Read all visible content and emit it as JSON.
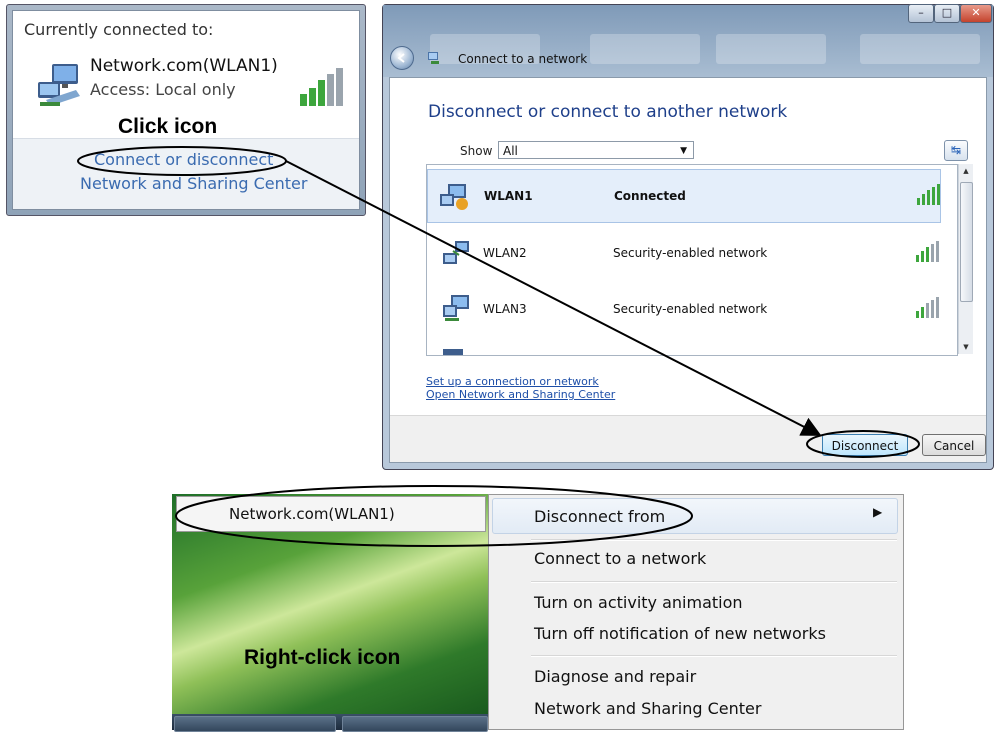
{
  "popup": {
    "heading": "Currently connected to:",
    "network_name": "Network.com(WLAN1)",
    "access": "Access:  Local only",
    "link_connect": "Connect or disconnect",
    "link_center": "Network and Sharing Center",
    "annotation": "Click icon"
  },
  "dialog": {
    "breadcrumb": "Connect to a network",
    "heading": "Disconnect or connect to another network",
    "show_label": "Show",
    "show_value": "All",
    "networks": [
      {
        "name": "WLAN1",
        "status": "Connected",
        "selected": true
      },
      {
        "name": "WLAN2",
        "status": "Security-enabled network",
        "selected": false
      },
      {
        "name": "WLAN3",
        "status": "Security-enabled network",
        "selected": false
      }
    ],
    "link_setup": "Set up a connection or network",
    "link_center": "Open Network and Sharing Center",
    "btn_disconnect": "Disconnect",
    "btn_cancel": "Cancel",
    "accent": "#1e3f8a"
  },
  "context": {
    "tray_label": "Network.com(WLAN1)",
    "annotation": "Right-click icon",
    "menu": [
      "Disconnect from",
      "Connect to a network",
      "Turn on activity animation",
      "Turn off notification of new networks",
      "Diagnose and repair",
      "Network and Sharing Center"
    ]
  },
  "icons": [
    "network-computer-icon",
    "signal-bars-icon",
    "back-icon",
    "refresh-icon",
    "dropdown-arrow-icon",
    "submenu-arrow-icon",
    "minimize-icon",
    "maximize-icon",
    "close-icon"
  ]
}
